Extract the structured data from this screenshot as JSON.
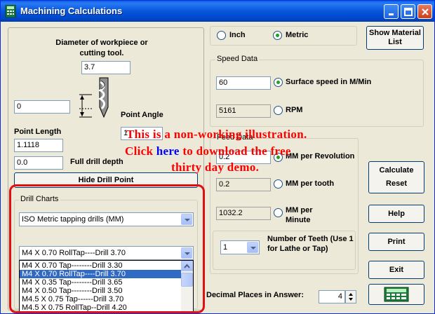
{
  "window": {
    "title": "Machining Calculations",
    "accent": "#0054e3"
  },
  "units": {
    "inch_label": "Inch",
    "metric_label": "Metric",
    "selected": "metric"
  },
  "buttons": {
    "show_material_list": "Show Material List",
    "hide_drill_point": "Hide Drill Point",
    "calculate": "Calculate",
    "reset": "Reset",
    "help": "Help",
    "print": "Print",
    "exit": "Exit"
  },
  "workpiece": {
    "diameter_label": "Diameter of workpiece or cutting tool.",
    "diameter_value": "3.7",
    "left_value": "0",
    "point_angle_label": "Point Angle",
    "point_angle_value": "1",
    "point_length_label": "Point Length",
    "point_length_value": "1.1118",
    "full_drill_depth_value": "0.0",
    "full_drill_depth_label": "Full drill depth"
  },
  "speed": {
    "group_title": "Speed Data",
    "surface_value": "60",
    "surface_label": "Surface speed in M/Min",
    "rpm_value": "5161",
    "rpm_label": "RPM"
  },
  "feed": {
    "group_title": "Feed Data",
    "per_rev_value": "0.2",
    "per_rev_label": "MM per Revolution",
    "per_tooth_value": "0.2",
    "per_tooth_label": "MM per tooth",
    "per_min_value": "1032.2",
    "per_min_label": "MM per Minute",
    "teeth_value": "1",
    "teeth_label": "Number of Teeth (Use 1 for Lathe or Tap)"
  },
  "drill_charts": {
    "group_title": "Drill Charts",
    "chart_value": "ISO Metric tapping drills (MM)",
    "selection_value": "M4 X 0.70 RollTap----Drill 3.70",
    "items": [
      "M4 X 0.70 Tap--------Drill 3.30",
      "M4 X 0.70 RollTap----Drill 3.70",
      "M4 X 0.35 Tap--------Drill 3.65",
      "M4 X 0.50 Tap--------Drill 3.50",
      "M4.5 X 0.75 Tap------Drill 3.70",
      "M4.5 X 0.75 RollTap--Drill 4.20"
    ],
    "selected_index": 1
  },
  "decimals": {
    "label": "Decimal Places in Answer:",
    "value": "4"
  },
  "overlay": {
    "line1": "This is a non-working illustration.",
    "line2_pre": "Click",
    "line2_link": "here",
    "line2_post": "to download the free",
    "line3": "thirty day demo."
  },
  "icons": {
    "app": "calculator-icon",
    "minimize": "minimize-icon",
    "maximize": "maximize-icon",
    "close": "close-icon"
  }
}
